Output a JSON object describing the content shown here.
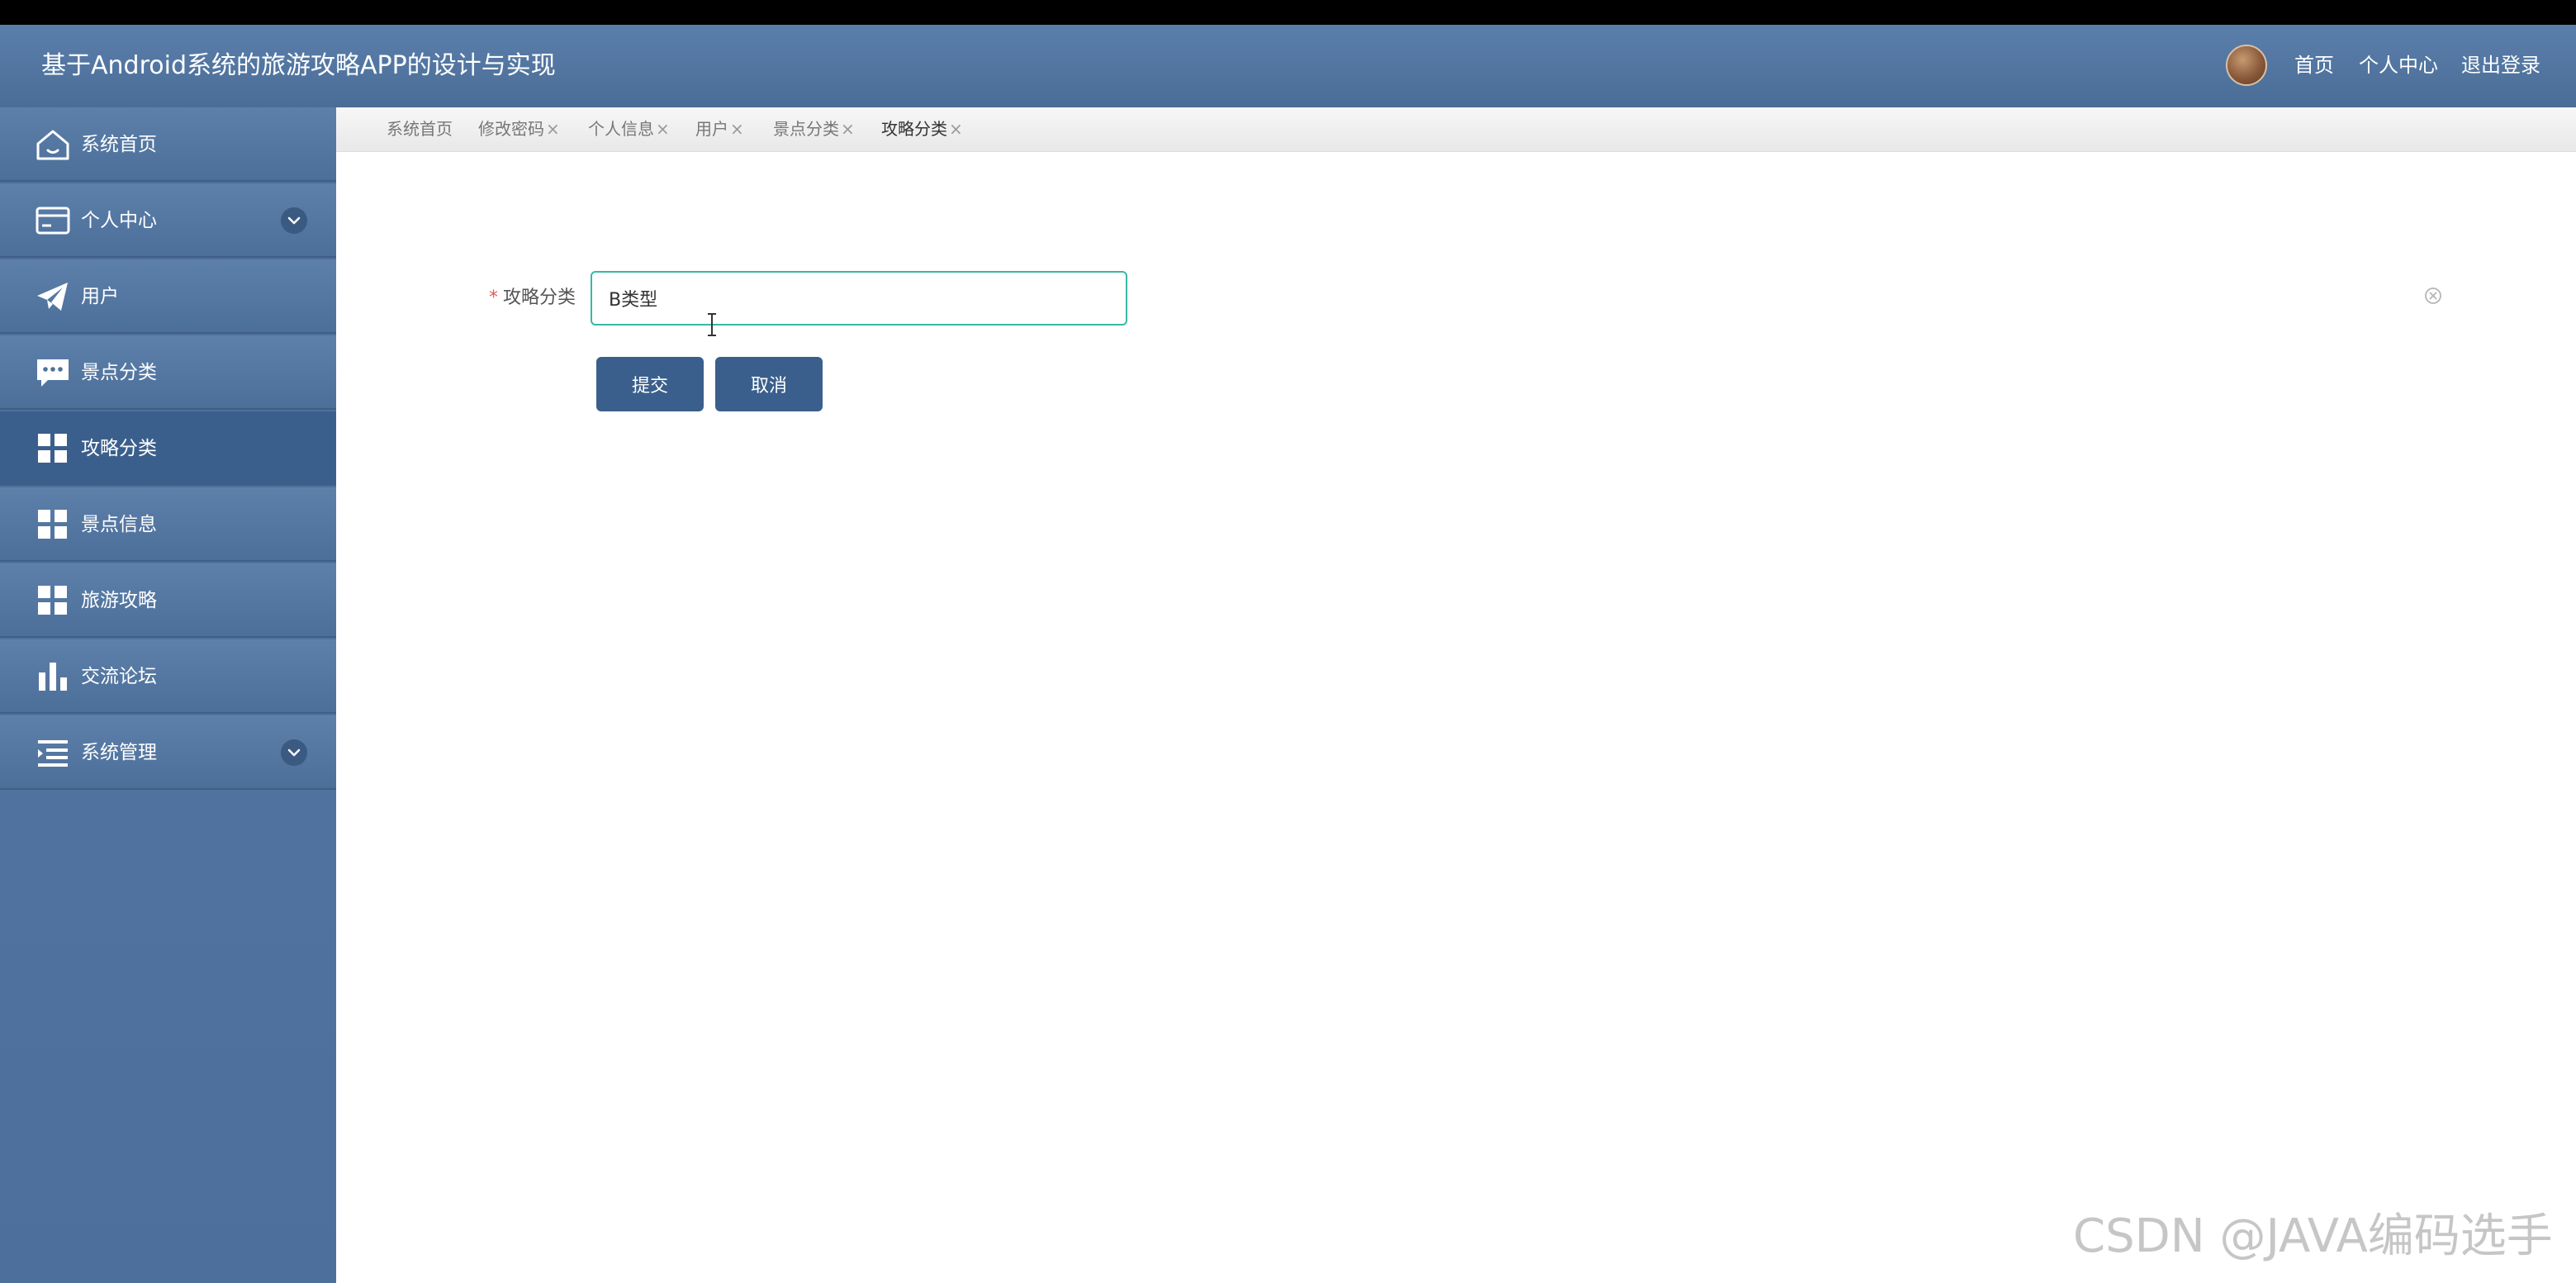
{
  "header": {
    "title": "基于Android系统的旅游攻略APP的设计与实现",
    "nav": [
      "首页",
      "个人中心",
      "退出登录"
    ]
  },
  "sidebar": {
    "items": [
      {
        "label": "系统首页",
        "icon": "home-icon"
      },
      {
        "label": "个人中心",
        "icon": "card-icon",
        "expandable": true
      },
      {
        "label": "用户",
        "icon": "paper-plane-icon"
      },
      {
        "label": "景点分类",
        "icon": "chat-icon"
      },
      {
        "label": "攻略分类",
        "icon": "grid-icon",
        "active": true
      },
      {
        "label": "景点信息",
        "icon": "grid-icon"
      },
      {
        "label": "旅游攻略",
        "icon": "grid-icon"
      },
      {
        "label": "交流论坛",
        "icon": "bar-chart-icon"
      },
      {
        "label": "系统管理",
        "icon": "list-icon",
        "expandable": true
      }
    ]
  },
  "tabs": [
    {
      "label": "系统首页",
      "closable": false
    },
    {
      "label": "修改密码",
      "closable": true
    },
    {
      "label": "个人信息",
      "closable": true
    },
    {
      "label": "用户",
      "closable": true
    },
    {
      "label": "景点分类",
      "closable": true
    },
    {
      "label": "攻略分类",
      "closable": true,
      "active": true
    }
  ],
  "tab_close_glyph": "×",
  "form": {
    "required_mark": "*",
    "field_label": "攻略分类",
    "field_value": "B类型",
    "submit_label": "提交",
    "cancel_label": "取消"
  },
  "watermark": "CSDN @JAVA编码选手",
  "colors": {
    "primary": "#3b5f8c",
    "header": "#4e7099",
    "input_border": "#39b8a6",
    "required": "#e35b5b"
  }
}
